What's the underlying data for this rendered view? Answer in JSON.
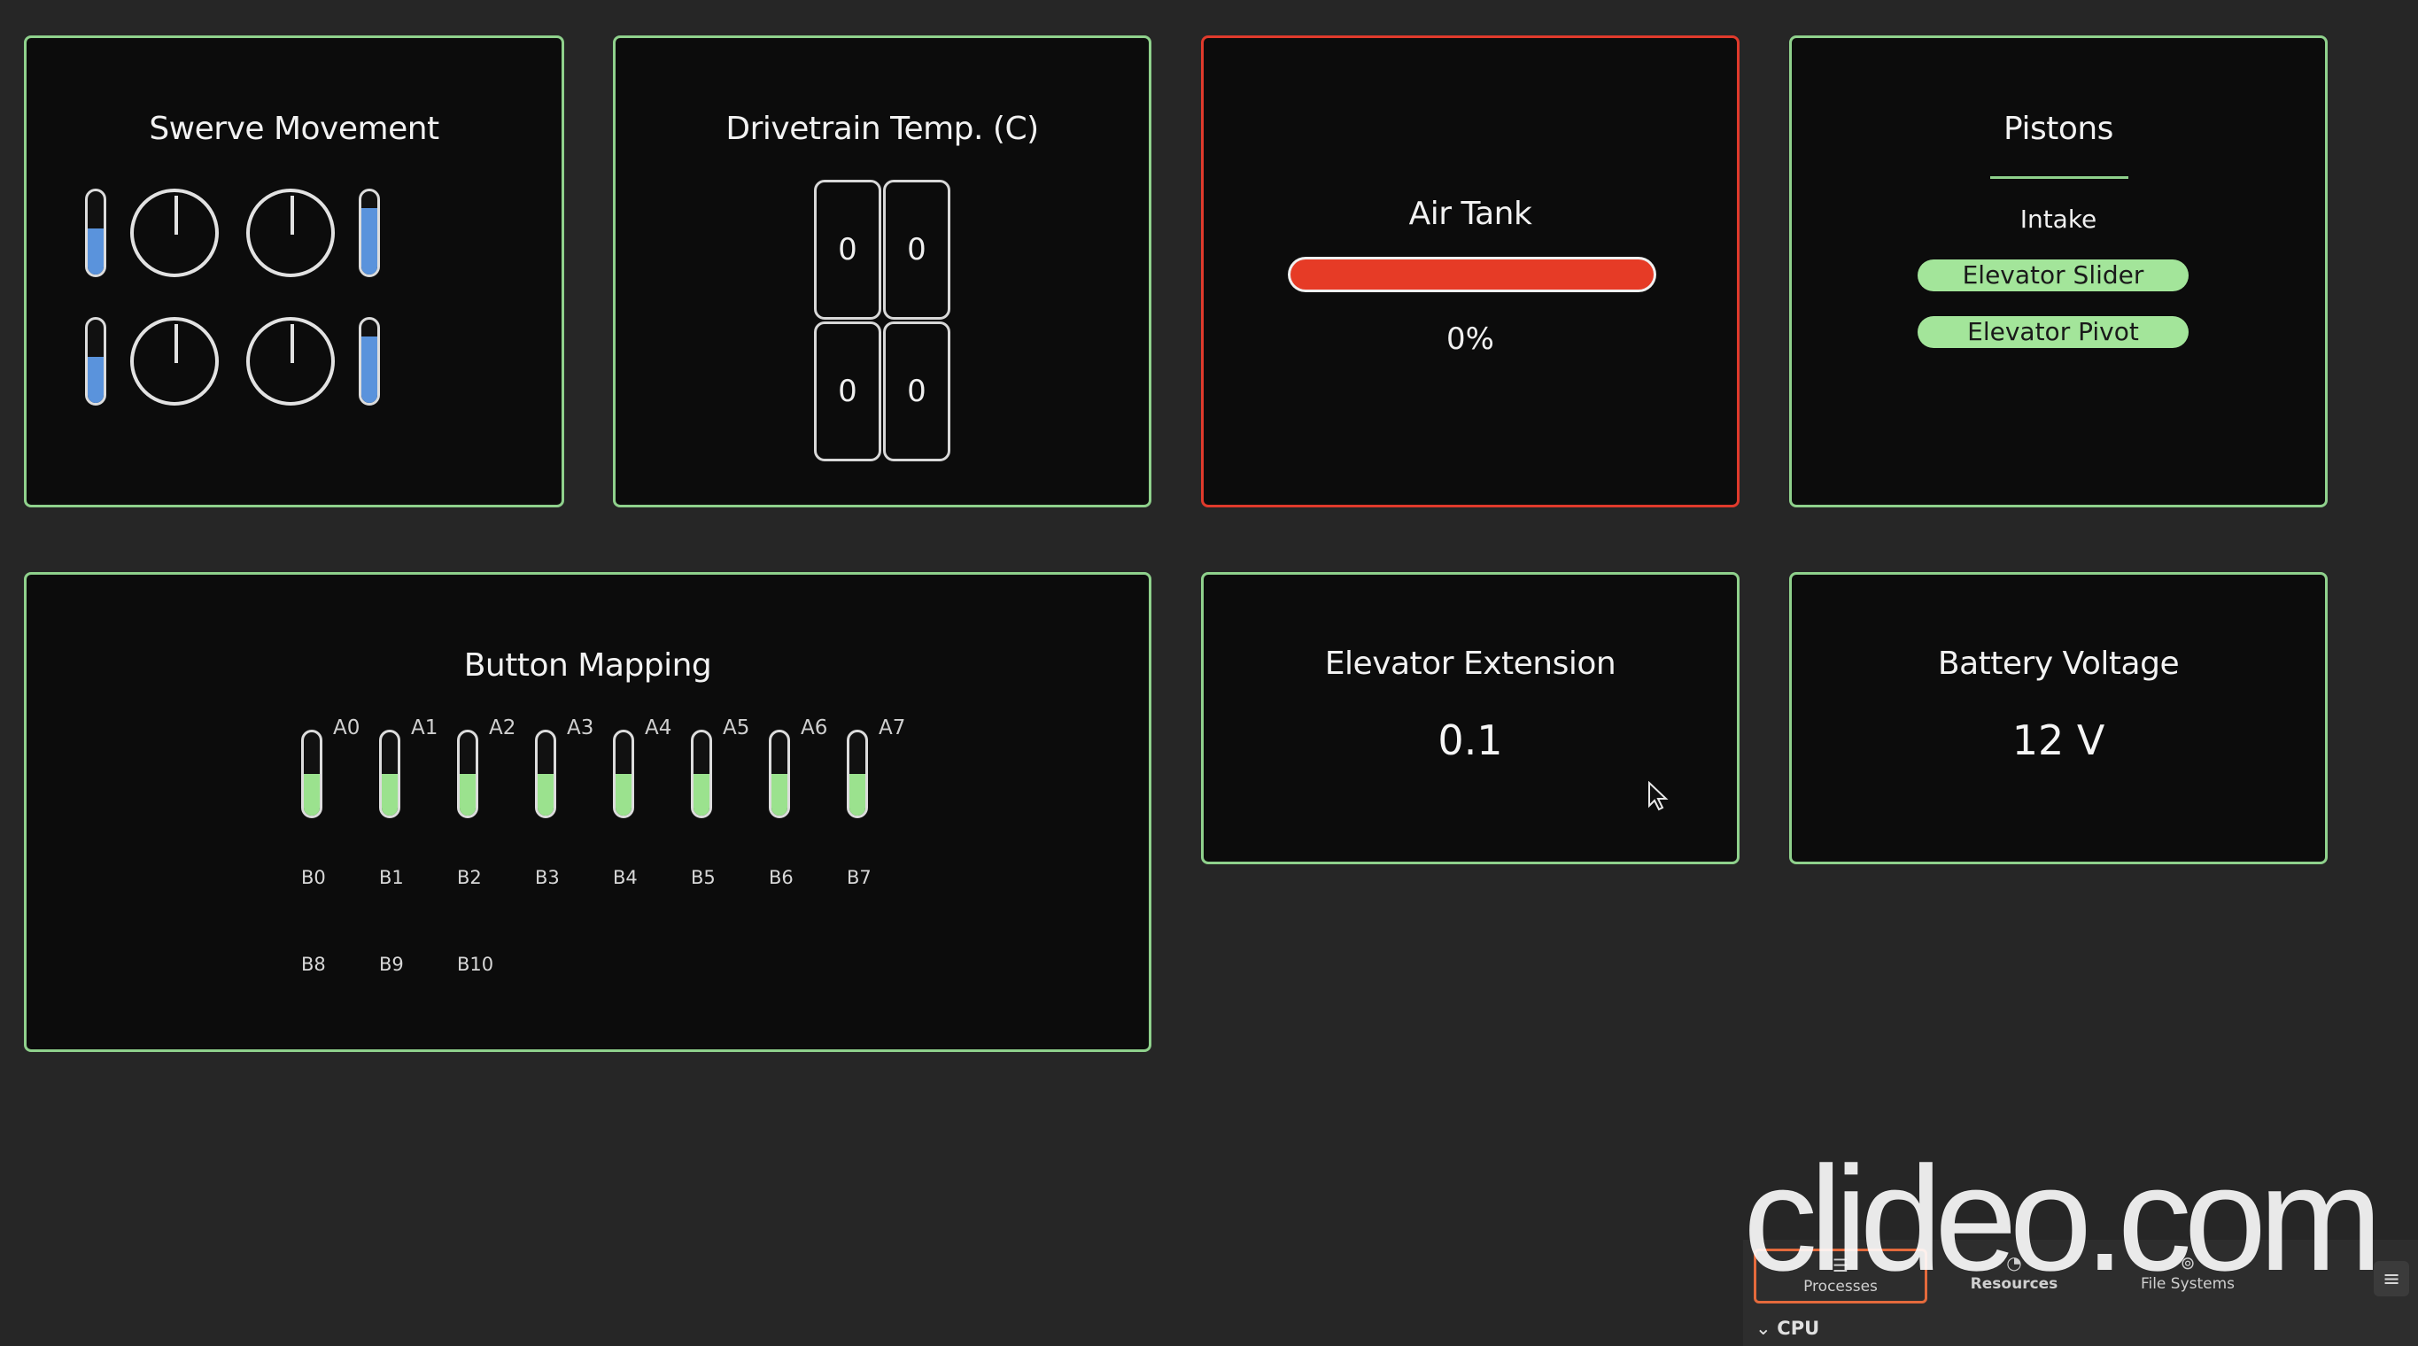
{
  "swerve": {
    "title": "Swerve Movement",
    "speed_levels": [
      0.55,
      0.8,
      0.55,
      0.8
    ]
  },
  "drivetrain": {
    "title": "Drivetrain Temp. (C)",
    "temps": [
      "0",
      "0",
      "0",
      "0"
    ]
  },
  "air_tank": {
    "title": "Air Tank",
    "value": "0%",
    "bar_color": "#e63b26"
  },
  "pistons": {
    "title": "Pistons",
    "items": [
      "Intake",
      "Elevator Slider",
      "Elevator Pivot"
    ],
    "active_color": "#a3e59a"
  },
  "button_mapping": {
    "title": "Button Mapping",
    "axes": [
      {
        "label": "A0",
        "level": 0.5
      },
      {
        "label": "A1",
        "level": 0.5
      },
      {
        "label": "A2",
        "level": 0.5
      },
      {
        "label": "A3",
        "level": 0.5
      },
      {
        "label": "A4",
        "level": 0.5
      },
      {
        "label": "A5",
        "level": 0.5
      },
      {
        "label": "A6",
        "level": 0.5
      },
      {
        "label": "A7",
        "level": 0.5
      }
    ],
    "buttons_row1": [
      "B0",
      "B1",
      "B2",
      "B3",
      "B4",
      "B5",
      "B6",
      "B7"
    ],
    "buttons_row2": [
      "B8",
      "B9",
      "B10"
    ]
  },
  "elevator_extension": {
    "title": "Elevator Extension",
    "value": "0.1"
  },
  "battery": {
    "title": "Battery Voltage",
    "value": "12 V"
  },
  "colors": {
    "panel_border_ok": "#8fd18c",
    "panel_border_alert": "#e03a2c",
    "speed_fill": "#5a93dc",
    "axis_fill": "#9be28e"
  },
  "watermark": "clideo.com",
  "system_monitor": {
    "tabs": [
      {
        "label": "Processes",
        "icon": "list-icon",
        "active": true
      },
      {
        "label": "Resources",
        "icon": "gauge-icon",
        "active": false
      },
      {
        "label": "File Systems",
        "icon": "disk-icon",
        "active": false
      }
    ],
    "section": "CPU"
  }
}
